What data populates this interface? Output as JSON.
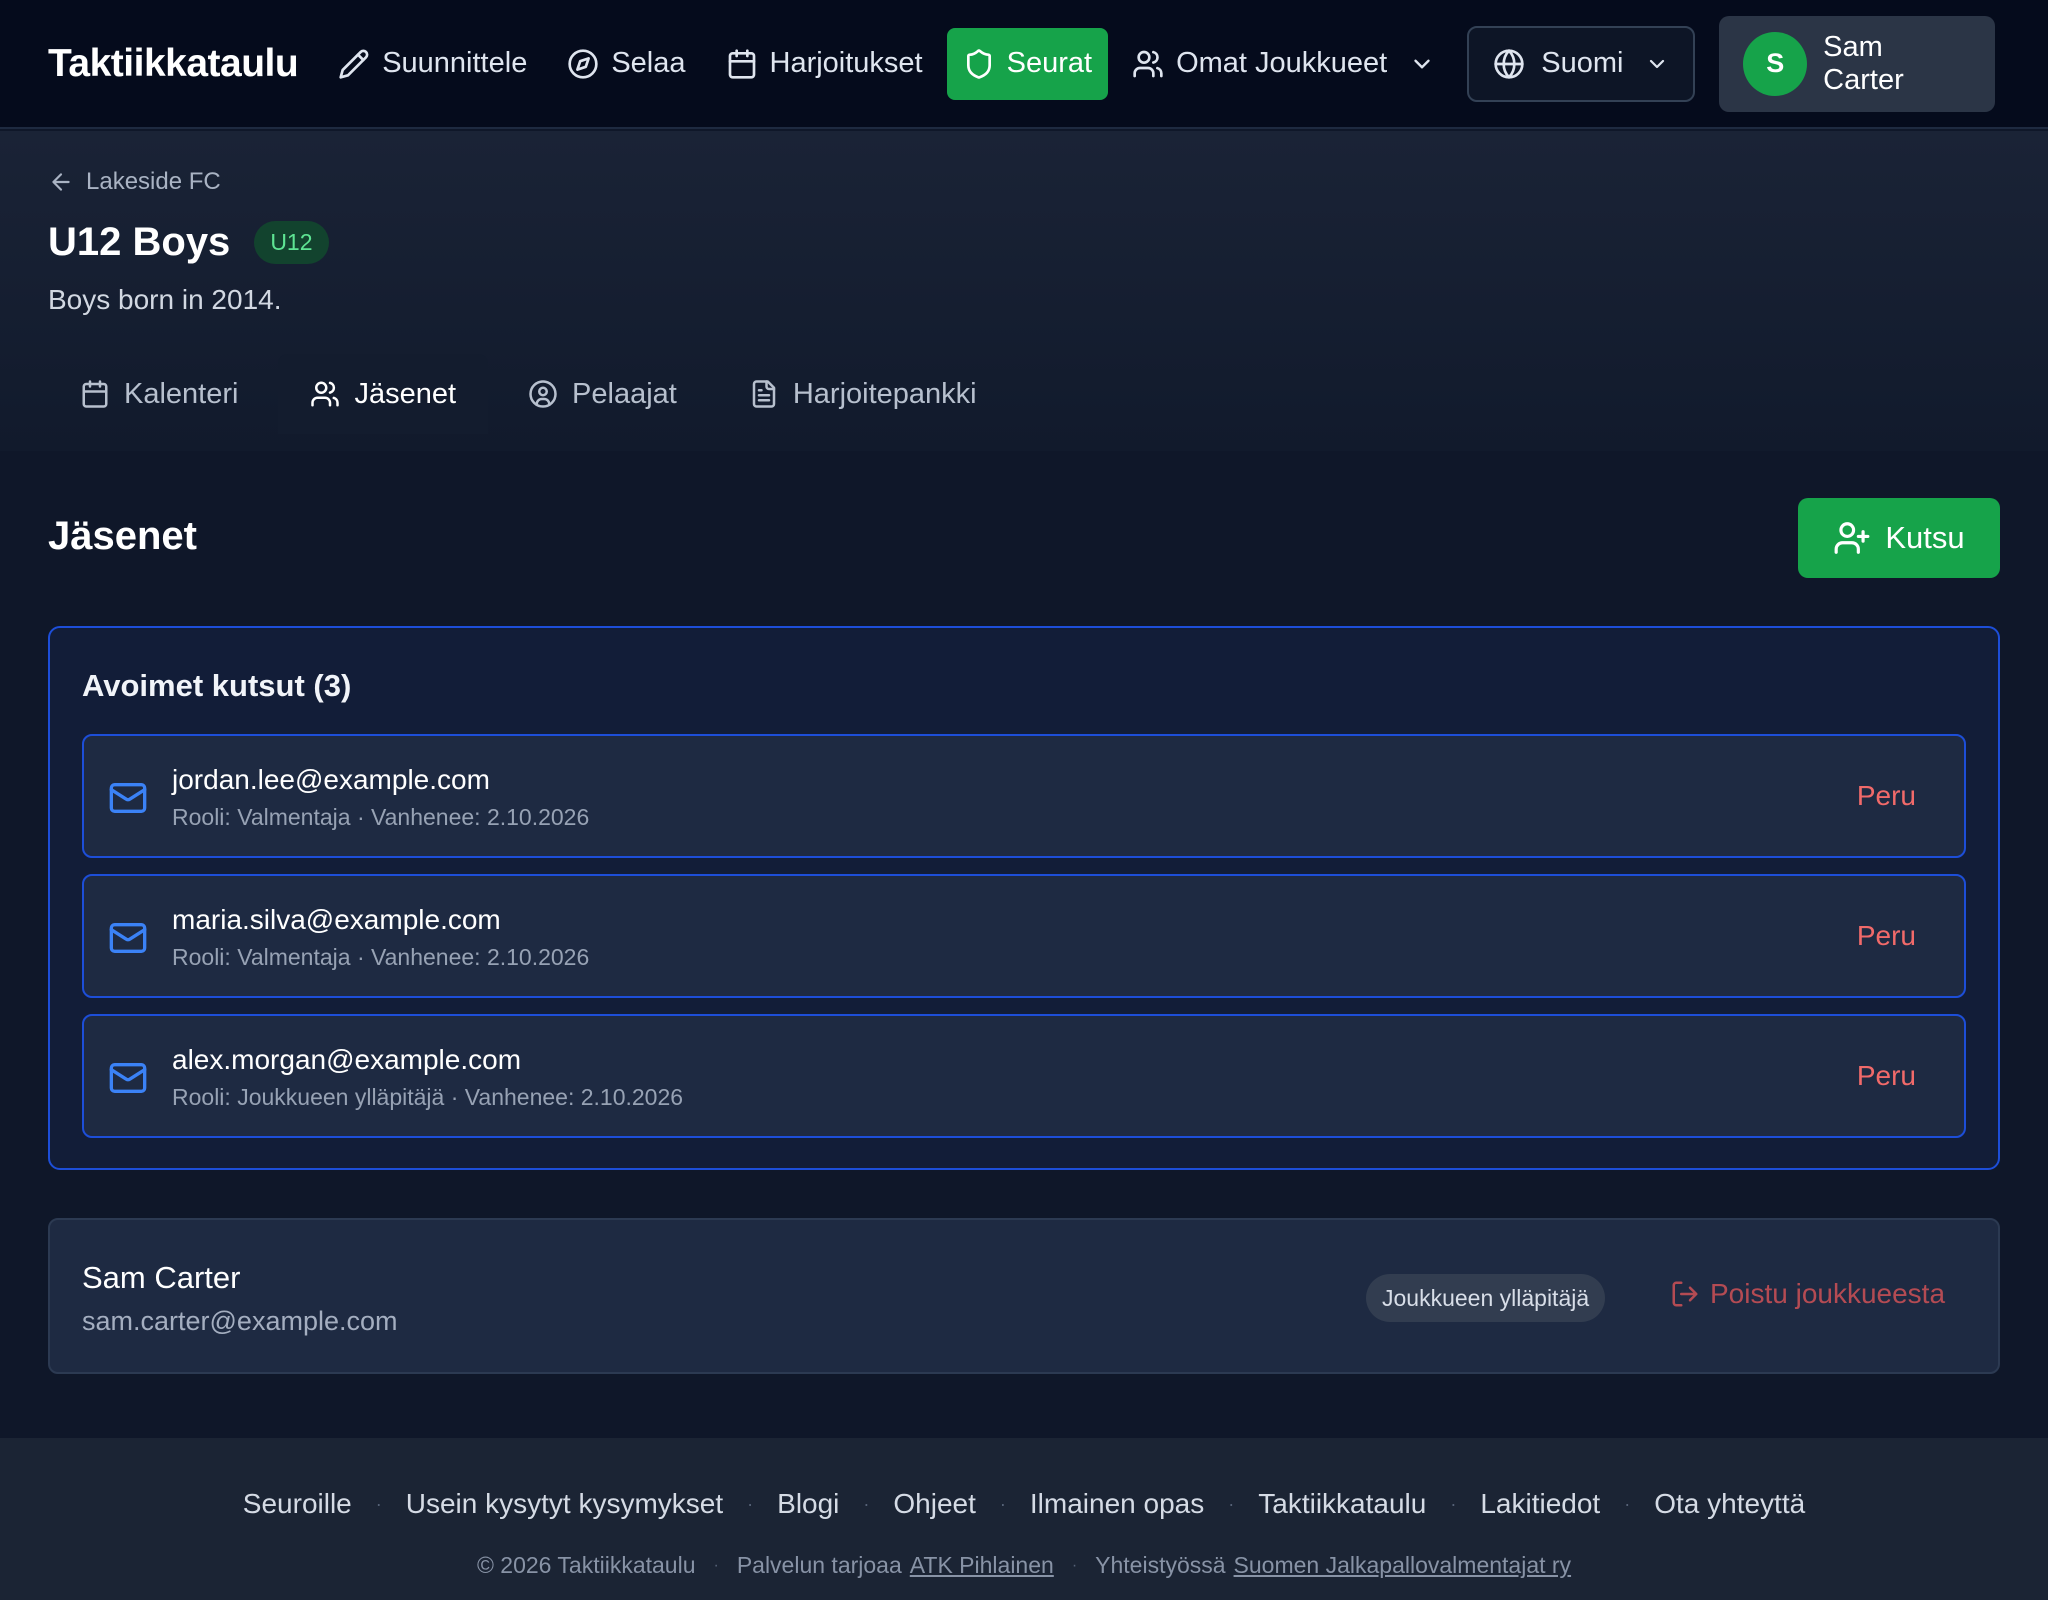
{
  "app": {
    "brand": "Taktiikkataulu"
  },
  "nav": {
    "items": [
      {
        "label": "Suunnittele",
        "icon": "pencil-icon"
      },
      {
        "label": "Selaa",
        "icon": "compass-icon"
      },
      {
        "label": "Harjoitukset",
        "icon": "calendar-icon"
      },
      {
        "label": "Seurat",
        "icon": "shield-icon",
        "active": true
      },
      {
        "label": "Omat Joukkueet",
        "icon": "users-icon"
      }
    ],
    "language": "Suomi",
    "user": {
      "initial": "S",
      "name": "Sam Carter"
    },
    "accent_color": "#16a34a"
  },
  "header": {
    "back_label": "Lakeside FC",
    "title": "U12 Boys",
    "age_badge": "U12",
    "description": "Boys born in 2014."
  },
  "tabs": [
    {
      "label": "Kalenteri",
      "icon": "calendar-icon"
    },
    {
      "label": "Jäsenet",
      "icon": "users-icon",
      "active": true
    },
    {
      "label": "Pelaajat",
      "icon": "user-circle-icon"
    },
    {
      "label": "Harjoitepankki",
      "icon": "document-icon"
    }
  ],
  "members_section": {
    "title": "Jäsenet",
    "invite_button": "Kutsu",
    "pending_title": "Avoimet kutsut (3)",
    "invites": [
      {
        "email": "jordan.lee@example.com",
        "meta": "Rooli: Valmentaja · Vanhenee: 2.10.2026",
        "action": "Peru"
      },
      {
        "email": "maria.silva@example.com",
        "meta": "Rooli: Valmentaja · Vanhenee: 2.10.2026",
        "action": "Peru"
      },
      {
        "email": "alex.morgan@example.com",
        "meta": "Rooli: Joukkueen ylläpitäjä · Vanhenee: 2.10.2026",
        "action": "Peru"
      }
    ],
    "member": {
      "name": "Sam Carter",
      "email": "sam.carter@example.com",
      "role": "Joukkueen ylläpitäjä",
      "leave_label": "Poistu joukkueesta"
    }
  },
  "footer": {
    "links": [
      "Seuroille",
      "Usein kysytyt kysymykset",
      "Blogi",
      "Ohjeet",
      "Ilmainen opas",
      "Taktiikkataulu",
      "Lakitiedot",
      "Ota yhteyttä"
    ],
    "copyright": "© 2026 Taktiikkataulu",
    "provided_prefix": "Palvelun tarjoaa",
    "provided_link": "ATK Pihlainen",
    "partner_prefix": "Yhteistyössä",
    "partner_link": "Suomen Jalkapallovalmentajat ry"
  }
}
